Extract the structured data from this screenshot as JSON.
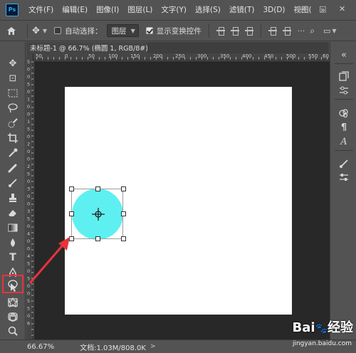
{
  "app": {
    "logo": "Ps",
    "menu": [
      "文件(F)",
      "编辑(E)",
      "图像(I)",
      "图层(L)",
      "文字(Y)",
      "选择(S)",
      "滤镜(T)",
      "3D(D)",
      "视图("
    ],
    "menu_more": "»"
  },
  "options_bar": {
    "auto_select_label": "自动选择：",
    "layer_select_value": "图层",
    "show_transform_label": "显示变换控件"
  },
  "document": {
    "tab_title": "未标题-1 @ 66.7% (椭圆 1, RGB/8#) *",
    "ruler_top_labels": [
      "50",
      "0",
      "50",
      "100",
      "150",
      "200",
      "250",
      "300",
      "350",
      "400",
      "450",
      "500",
      "550",
      "60"
    ],
    "ruler_left_labels": [
      "5",
      "0",
      "0",
      "5",
      "0",
      "1",
      "0",
      "0",
      "1",
      "5",
      "0",
      "2",
      "0",
      "0",
      "2",
      "5",
      "0",
      "3",
      "0",
      "0",
      "3",
      "5",
      "0",
      "4",
      "0",
      "0",
      "4",
      "5",
      "0",
      "5",
      "0",
      "0",
      "5",
      "5",
      "0",
      "6"
    ],
    "ellipse_color": "#5ef0f0",
    "canvas_color": "#ffffff"
  },
  "status": {
    "zoom": "66.67%",
    "doc_info": "文档:1.03M/808.0K",
    "arrow": ">"
  },
  "watermark": {
    "brand": "Bai",
    "brand2": "经验",
    "url": "jingyan.baidu.com"
  }
}
